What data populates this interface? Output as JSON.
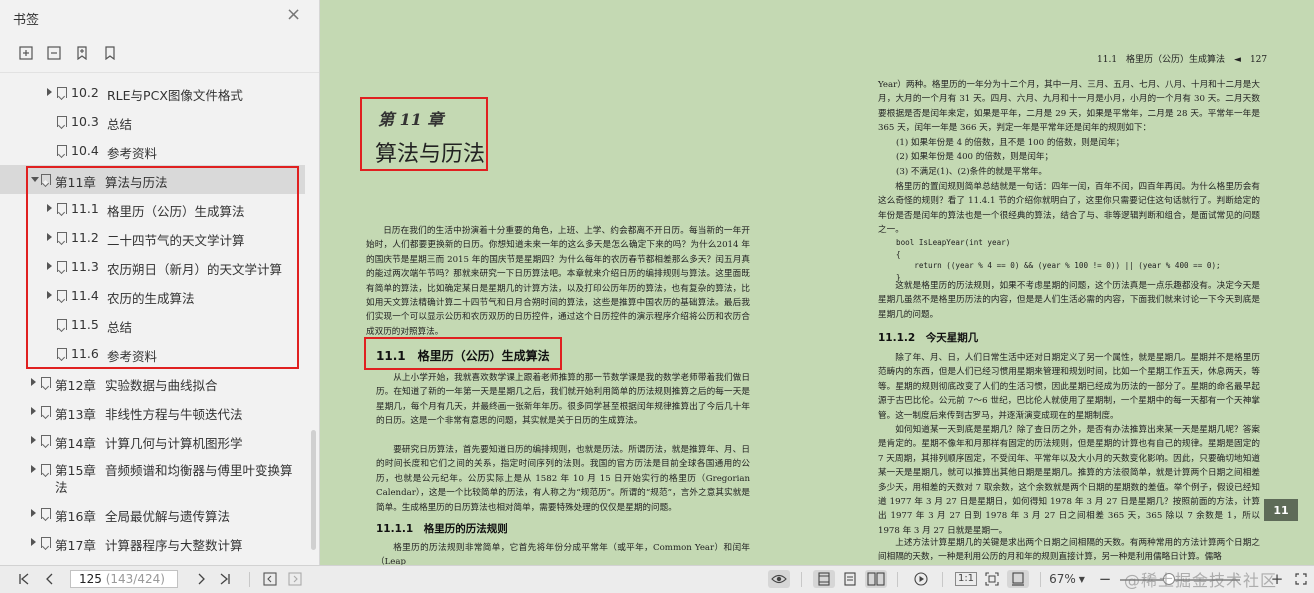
{
  "sidebar": {
    "title": "书签",
    "close_icon": "×",
    "items": [
      {
        "num": "10.2",
        "text": "RLE与PCX图像文件格式",
        "arrow": "right",
        "level": 1
      },
      {
        "num": "10.3",
        "text": "总结",
        "arrow": "none",
        "level": 1
      },
      {
        "num": "10.4",
        "text": "参考资料",
        "arrow": "none",
        "level": 1
      },
      {
        "num": "第11章",
        "text": "算法与历法",
        "arrow": "down",
        "level": 0
      },
      {
        "num": "11.1",
        "text": "格里历（公历）生成算法",
        "arrow": "right",
        "level": 1
      },
      {
        "num": "11.2",
        "text": "二十四节气的天文学计算",
        "arrow": "right",
        "level": 1
      },
      {
        "num": "11.3",
        "text": "农历朔日（新月）的天文学计算",
        "arrow": "right",
        "level": 1
      },
      {
        "num": "11.4",
        "text": "农历的生成算法",
        "arrow": "right",
        "level": 1
      },
      {
        "num": "11.5",
        "text": "总结",
        "arrow": "none",
        "level": 1
      },
      {
        "num": "11.6",
        "text": "参考资料",
        "arrow": "none",
        "level": 1
      },
      {
        "num": "第12章",
        "text": "实验数据与曲线拟合",
        "arrow": "right",
        "level": 0
      },
      {
        "num": "第13章",
        "text": "非线性方程与牛顿迭代法",
        "arrow": "right",
        "level": 0
      },
      {
        "num": "第14章",
        "text": "计算几何与计算机图形学",
        "arrow": "right",
        "level": 0
      },
      {
        "num": "第15章",
        "text": "音频频谱和均衡器与傅里叶变换算",
        "text2": "法",
        "arrow": "right",
        "level": 0
      },
      {
        "num": "第16章",
        "text": "全局最优解与遗传算法",
        "arrow": "right",
        "level": 0
      },
      {
        "num": "第17章",
        "text": "计算器程序与大整数计算",
        "arrow": "right",
        "level": 0
      }
    ]
  },
  "left_page": {
    "chapter_label": "第 11 章",
    "chapter_title": "算法与历法",
    "intro": "日历在我们的生活中扮演着十分重要的角色，上班、上学、约会都离不开日历。每当新的一年开始时，人们都要更换新的日历。你想知道未来一年的这么多天是怎么确定下来的吗？为什么2014 年的国庆节是星期三而 2015 年的国庆节是星期四？为什么每年的农历春节都相差那么多天？闰五月真的能过两次端午节吗？那就来研究一下日历算法吧。本章就来介绍日历的编排规则与算法。这里面既有简单的算法，比如确定某日是星期几的计算方法，以及打印公历年历的算法，也有复杂的算法，比如用天文算法精确计算二十四节气和日月合朔时间的算法，这些是推算中国农历的基础算法。最后我们实现一个可以显示公历和农历双历的日历控件，通过这个日历控件的演示程序介绍将公历和农历合成双历的对照算法。",
    "section_title": "11.1　格里历（公历）生成算法",
    "section_p1": "从上小学开始，我就喜欢数学课上跟着老师推算的那一节数学课是我的数学老师带着我们做日历。在知道了新的一年第一天是星期几之后，我们就开始利用简单的历法规则推算之后的每一天是星期几，每个月有几天，并最终画一张新年年历。很多同学甚至根据闰年规律推算出了今后几十年的日历。这是一个非常有意思的问题，其实就是关于日历的生成算法。",
    "section_p2": "要研究日历算法，首先要知道日历的编排规则，也就是历法。所谓历法，就是推算年、月、日的时间长度和它们之间的关系，指定时间序列的法则。我国的官方历法是目前全球各国通用的公历，也就是公元纪年。公历实际上是从 1582 年 10 月 15 日开始实行的格里历（Gregorian Calendar），这是一个比较简单的历法，有人称之为“规范历”。所谓的“规范”，言外之意其实就是简单。生成格里历的日历算法也相对简单，需要特殊处理的仅仅是星期的问题。",
    "subsection_title": "11.1.1　格里历的历法规则",
    "subsection_p": "格里历的历法规则非常简单，它首先将年份分成平常年（或平年，Common Year）和闰年（Leap"
  },
  "right_page": {
    "header": "11.1　格里历（公历）生成算法　◄　127",
    "p1": "Year）两种。格里历的一年分为十二个月，其中一月、三月、五月、七月、八月、十月和十二月是大月，大月的一个月有 31 天。四月、六月、九月和十一月是小月，小月的一个月有 30 天。二月天数要根据是否是闰年来定，如果是平年，二月是 29 天，如果是平常年，二月是 28 天。平常年一年是 365 天，闰年一年是 366 天，判定一年是平常年还是闰年的规则如下：",
    "rules": [
      "(1) 如果年份是 4 的倍数，且不是 100 的倍数，则是闰年；",
      "(2) 如果年份是 400 的倍数，则是闰年；",
      "(3) 不满足(1)、(2)条件的就是平常年。"
    ],
    "p2": "格里历的置闰规则简单总结就是一句话：四年一闰，百年不闰，四百年再闰。为什么格里历会有这么奇怪的规则？看了 11.4.1 节的介绍你就明白了，这里你只需要记住这句话就行了。判断给定的年份是否是闰年的算法也是一个很经典的算法，结合了与、非等逻辑判断和组合，是面试常见的问题之一。",
    "code": "bool IsLeapYear(int year)\n{\n    return ((year % 4 == 0) && (year % 100 != 0)) || (year % 400 == 0);\n}",
    "p3": "这就是格里历的历法规则，如果不考虑星期的问题，这个历法真是一点乐趣都没有。决定今天是星期几虽然不是格里历历法的内容，但是是人们生活必需的内容，下面我们就来讨论一下今天到底是星期几的问题。",
    "sub_title": "11.1.2　今天星期几",
    "p4": "除了年、月、日，人们日常生活中还对日期定义了另一个属性，就是星期几。星期并不是格里历范畴内的东西，但是人们已经习惯用星期来管理和规划时间，比如一个星期工作五天，休息两天，等等。星期的规则彻底改变了人们的生活习惯，因此星期已经成为历法的一部分了。星期的命名最早起源于古巴比伦。公元前 7～6 世纪，巴比伦人就使用了星期制，一个星期中的每一天都有一个天神掌管。这一制度后来传到古罗马，并逐渐演变成现在的星期制度。",
    "p5": "如何知道某一天到底是星期几？除了查日历之外，是否有办法推算出来某一天是星期几呢？答案是肯定的。星期不像年和月那样有固定的历法规则，但是星期的计算也有自己的规律。星期是固定的 7 天周期，其排列顺序固定，不受闰年、平常年以及大小月的天数变化影响。因此，只要确切地知道某一天是星期几，就可以推算出其他日期是星期几。推算的方法很简单，就是计算两个日期之间相差多少天，用相差的天数对 7 取余数，这个余数就是两个日期的星期数的差值。举个例子，假设已经知道 1977 年 3 月 27 日是星期日，如何得知 1978 年 3 月 27 日是星期几？按照前面的方法，计算出 1977 年 3 月 27 日到 1978 年 3 月 27 日之间相差 365 天，365 除以 7 余数是 1，所以 1978 年 3 月 27 日就是星期一。",
    "p6": "上述方法计算星期几的关键是求出两个日期之间相隔的天数。有两种常用的方法计算两个日期之间相隔的天数，一种是利用公历的月和年的规则直接计算，另一种是利用儒略日计算。儒略",
    "tab": "11"
  },
  "bottom_bar": {
    "page_current": "125",
    "page_info": " (143/424)",
    "zoom": "67%",
    "fit_label": "1:1"
  },
  "watermark": "@稀土掘金技术社区"
}
